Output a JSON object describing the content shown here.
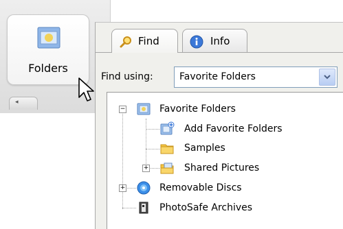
{
  "toolbar": {
    "folders_label": "Folders"
  },
  "tabs": [
    {
      "label": "Find",
      "icon": "search-icon",
      "active": true
    },
    {
      "label": "Info",
      "icon": "info-icon",
      "active": false
    }
  ],
  "find": {
    "label": "Find using:",
    "selected": "Favorite Folders"
  },
  "tree": [
    {
      "label": "Favorite Folders",
      "icon": "favorite-folder-icon",
      "expander": "minus"
    },
    {
      "label": "Add Favorite Folders",
      "icon": "add-folder-icon"
    },
    {
      "label": "Samples",
      "icon": "folder-icon"
    },
    {
      "label": "Shared Pictures",
      "icon": "shared-pictures-icon",
      "expander": "plus"
    },
    {
      "label": "Removable Discs",
      "icon": "disc-icon",
      "expander": "plus"
    },
    {
      "label": "PhotoSafe Archives",
      "icon": "archive-icon"
    }
  ],
  "colors": {
    "accent_blue": "#3b78d8",
    "folder_yellow": "#f5c542"
  }
}
